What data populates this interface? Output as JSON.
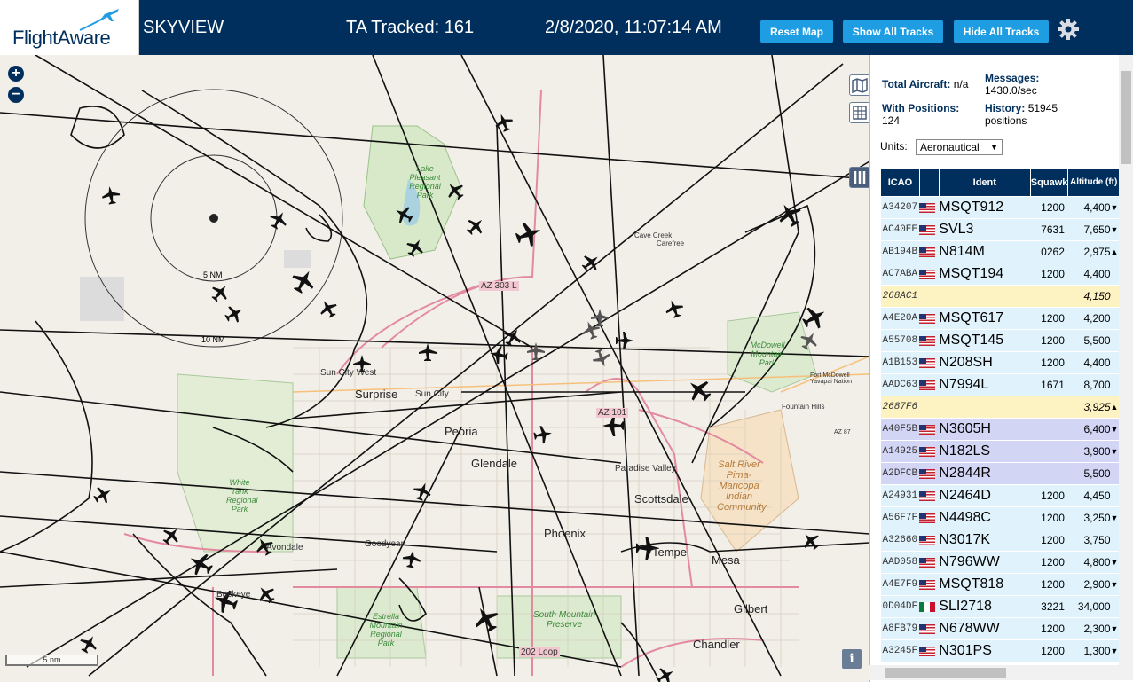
{
  "header": {
    "logo_text": "FlightAware",
    "app_title": "SKYVIEW",
    "tracked": "TA Tracked: 161",
    "datetime": "2/8/2020, 11:07:14 AM",
    "reset_map": "Reset Map",
    "show_tracks": "Show All Tracks",
    "hide_tracks": "Hide All Tracks",
    "settings_icon": "gear-icon"
  },
  "map": {
    "zoom_in": "+",
    "zoom_out": "−",
    "ring_labels": [
      "5 NM",
      "10 NM"
    ],
    "cities": [
      "Sun City West",
      "Sun City",
      "Surprise",
      "Peoria",
      "Glendale",
      "Phoenix",
      "Scottsdale",
      "Paradise Valley",
      "Tempe",
      "Mesa",
      "Gilbert",
      "Chandler",
      "Avondale",
      "Goodyear",
      "Buckeye",
      "Cave Creek",
      "Carefree",
      "Fountain Hills",
      "Fort McDowell Yavapai Nation"
    ],
    "parks": [
      "Lake Pleasant Regional Park",
      "White Tank Regional Park",
      "Estrella Mountain Regional Park",
      "South Mountain Preserve",
      "McDowell Mountain Park",
      "Salt River Pima-Maricopa Indian Community"
    ],
    "road_labels": [
      "AZ 303 L",
      "AZ 101",
      "AZ 87",
      "202 Loop"
    ],
    "scale": "5 nm",
    "info": "i",
    "tool_icons": [
      "map-layers-icon",
      "grid-icon",
      "columns-icon"
    ]
  },
  "panel": {
    "total_aircraft_label": "Total Aircraft:",
    "total_aircraft_value": "n/a",
    "with_positions_label": "With Positions:",
    "with_positions_value": "124",
    "messages_label": "Messages:",
    "messages_value": "1430.0/sec",
    "history_label": "History:",
    "history_value": "51945 positions",
    "units_label": "Units:",
    "units_value": "Aeronautical",
    "columns": [
      "ICAO",
      "",
      "Ident",
      "Squawk",
      "Altitude (ft)"
    ],
    "rows": [
      {
        "icao": "A34207",
        "flag": "us",
        "ident": "MSQT912",
        "squawk": "1200",
        "alt": "4,400",
        "trend": "▼",
        "style": "blue"
      },
      {
        "icao": "AC40EE",
        "flag": "us",
        "ident": "SVL3",
        "squawk": "7631",
        "alt": "7,650",
        "trend": "▼",
        "style": "blue"
      },
      {
        "icao": "AB194B",
        "flag": "us",
        "ident": "N814M",
        "squawk": "0262",
        "alt": "2,975",
        "trend": "▲",
        "style": "blue"
      },
      {
        "icao": "AC7ABA",
        "flag": "us",
        "ident": "MSQT194",
        "squawk": "1200",
        "alt": "4,400",
        "trend": "",
        "style": "blue"
      },
      {
        "icao": "268AC1",
        "flag": "",
        "ident": "",
        "squawk": "",
        "alt": "4,150",
        "trend": "",
        "style": "yellow"
      },
      {
        "icao": "A4E20A",
        "flag": "us",
        "ident": "MSQT617",
        "squawk": "1200",
        "alt": "4,200",
        "trend": "",
        "style": "blue"
      },
      {
        "icao": "A55708",
        "flag": "us",
        "ident": "MSQT145",
        "squawk": "1200",
        "alt": "5,500",
        "trend": "",
        "style": "blue"
      },
      {
        "icao": "A1B153",
        "flag": "us",
        "ident": "N208SH",
        "squawk": "1200",
        "alt": "4,400",
        "trend": "",
        "style": "blue"
      },
      {
        "icao": "AADC63",
        "flag": "us",
        "ident": "N7994L",
        "squawk": "1671",
        "alt": "8,700",
        "trend": "",
        "style": "blue"
      },
      {
        "icao": "2687F6",
        "flag": "",
        "ident": "",
        "squawk": "",
        "alt": "3,925",
        "trend": "▲",
        "style": "yellow"
      },
      {
        "icao": "A40F5B",
        "flag": "us",
        "ident": "N3605H",
        "squawk": "",
        "alt": "6,400",
        "trend": "▼",
        "style": "purple"
      },
      {
        "icao": "A14925",
        "flag": "us",
        "ident": "N182LS",
        "squawk": "",
        "alt": "3,900",
        "trend": "▼",
        "style": "purple"
      },
      {
        "icao": "A2DFCB",
        "flag": "us",
        "ident": "N2844R",
        "squawk": "",
        "alt": "5,500",
        "trend": "",
        "style": "purple"
      },
      {
        "icao": "A24931",
        "flag": "us",
        "ident": "N2464D",
        "squawk": "1200",
        "alt": "4,450",
        "trend": "",
        "style": "blue"
      },
      {
        "icao": "A56F7F",
        "flag": "us",
        "ident": "N4498C",
        "squawk": "1200",
        "alt": "3,250",
        "trend": "▼",
        "style": "blue"
      },
      {
        "icao": "A32660",
        "flag": "us",
        "ident": "N3017K",
        "squawk": "1200",
        "alt": "3,750",
        "trend": "",
        "style": "blue"
      },
      {
        "icao": "AAD058",
        "flag": "us",
        "ident": "N796WW",
        "squawk": "1200",
        "alt": "4,800",
        "trend": "▼",
        "style": "blue"
      },
      {
        "icao": "A4E7F9",
        "flag": "us",
        "ident": "MSQT818",
        "squawk": "1200",
        "alt": "2,900",
        "trend": "▼",
        "style": "blue"
      },
      {
        "icao": "0D04DF",
        "flag": "mx",
        "ident": "SLI2718",
        "squawk": "3221",
        "alt": "34,000",
        "trend": "",
        "style": "blue"
      },
      {
        "icao": "A8FB79",
        "flag": "us",
        "ident": "N678WW",
        "squawk": "1200",
        "alt": "2,300",
        "trend": "▼",
        "style": "blue"
      },
      {
        "icao": "A3245F",
        "flag": "us",
        "ident": "N301PS",
        "squawk": "1200",
        "alt": "1,300",
        "trend": "▼",
        "style": "blue"
      }
    ]
  }
}
